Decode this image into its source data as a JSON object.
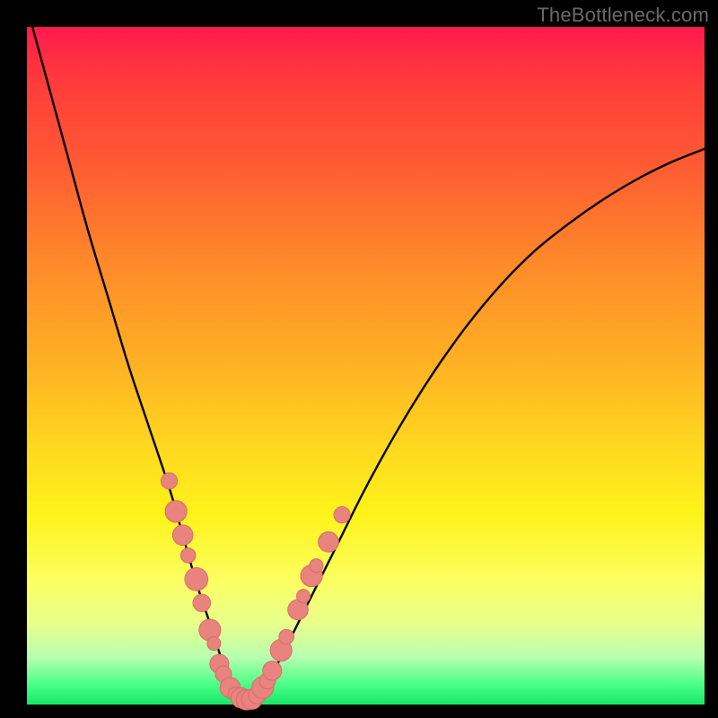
{
  "watermark": {
    "text": "TheBottleneck.com"
  },
  "colors": {
    "curve_stroke": "#000000",
    "marker_fill": "#e8837e",
    "marker_stroke": "#d96d67"
  },
  "chart_data": {
    "type": "line",
    "title": "",
    "xlabel": "",
    "ylabel": "",
    "xlim": [
      0,
      100
    ],
    "ylim": [
      0,
      100
    ],
    "grid": false,
    "legend": false,
    "series": [
      {
        "name": "bottleneck-curve",
        "x": [
          0,
          3,
          6,
          9,
          12,
          15,
          18,
          21,
          23,
          25,
          27,
          29,
          31,
          33,
          35,
          38,
          42,
          46,
          50,
          55,
          60,
          65,
          70,
          75,
          80,
          85,
          90,
          95,
          100
        ],
        "y": [
          103,
          92,
          81,
          70,
          60,
          50,
          41,
          32,
          25,
          18,
          12,
          6,
          2,
          0.7,
          2.5,
          8,
          16,
          24,
          32,
          41,
          49,
          56,
          62,
          67,
          71,
          74.5,
          77.5,
          80,
          82
        ]
      }
    ],
    "markers": [
      {
        "x": 21.0,
        "y": 33.0,
        "r": 1.2
      },
      {
        "x": 22.0,
        "y": 28.5,
        "r": 1.6
      },
      {
        "x": 23.0,
        "y": 25.0,
        "r": 1.5
      },
      {
        "x": 23.8,
        "y": 22.0,
        "r": 1.1
      },
      {
        "x": 25.0,
        "y": 18.5,
        "r": 1.7
      },
      {
        "x": 25.8,
        "y": 15.0,
        "r": 1.3
      },
      {
        "x": 27.0,
        "y": 11.0,
        "r": 1.6
      },
      {
        "x": 27.6,
        "y": 9.0,
        "r": 1.0
      },
      {
        "x": 28.4,
        "y": 6.0,
        "r": 1.4
      },
      {
        "x": 29.0,
        "y": 4.5,
        "r": 1.2
      },
      {
        "x": 30.0,
        "y": 2.5,
        "r": 1.5
      },
      {
        "x": 30.8,
        "y": 1.5,
        "r": 1.1
      },
      {
        "x": 31.6,
        "y": 1.0,
        "r": 1.5
      },
      {
        "x": 32.4,
        "y": 0.7,
        "r": 1.5
      },
      {
        "x": 33.2,
        "y": 0.8,
        "r": 1.5
      },
      {
        "x": 34.0,
        "y": 1.4,
        "r": 1.3
      },
      {
        "x": 34.8,
        "y": 2.5,
        "r": 1.6
      },
      {
        "x": 35.5,
        "y": 3.5,
        "r": 1.2
      },
      {
        "x": 36.2,
        "y": 5.0,
        "r": 1.4
      },
      {
        "x": 37.5,
        "y": 8.0,
        "r": 1.6
      },
      {
        "x": 38.3,
        "y": 10.0,
        "r": 1.1
      },
      {
        "x": 40.0,
        "y": 14.0,
        "r": 1.5
      },
      {
        "x": 40.8,
        "y": 16.0,
        "r": 1.0
      },
      {
        "x": 42.0,
        "y": 19.0,
        "r": 1.6
      },
      {
        "x": 42.7,
        "y": 20.5,
        "r": 1.0
      },
      {
        "x": 44.5,
        "y": 24.0,
        "r": 1.5
      },
      {
        "x": 46.5,
        "y": 28.0,
        "r": 1.2
      }
    ]
  }
}
